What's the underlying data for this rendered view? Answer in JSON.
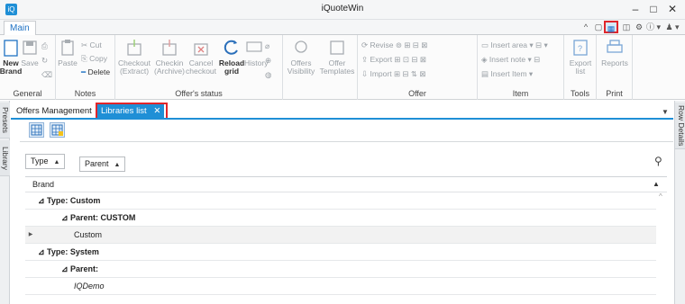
{
  "window": {
    "title": "iQuoteWin",
    "min": "–",
    "max": "□",
    "close": "✕"
  },
  "ribbon_tabs": {
    "main": "Main"
  },
  "quick_access": {
    "collapse": "^",
    "icon2": "▢",
    "grid_icon": "▦",
    "icon4": "◫",
    "settings": "⚙",
    "info": "ⓘ ▾",
    "user": "♟ ▾"
  },
  "ribbon": {
    "general": {
      "label": "General",
      "new_brand": "New Brand",
      "save": "Save"
    },
    "notes": {
      "label": "Notes",
      "paste": "Paste",
      "cut": "Cut",
      "copy": "Copy",
      "delete": "Delete"
    },
    "offer_status": {
      "label": "Offer's status",
      "checkout": "Checkout (Extract)",
      "checkin": "Checkin (Archive)",
      "cancel_checkout": "Cancel checkout",
      "reload_grid": "Reload grid",
      "history": "History",
      "offers_visibility": "Offers Visibility",
      "offer_templates": "Offer Templates"
    },
    "offer": {
      "label": "Offer",
      "revise": "Revise",
      "export": "Export",
      "import": "Import"
    },
    "item": {
      "label": "Item",
      "insert_area": "Insert area",
      "insert_note": "Insert note",
      "insert_item": "Insert Item"
    },
    "tools": {
      "label": "Tools",
      "export_list": "Export list"
    },
    "print": {
      "label": "Print",
      "reports": "Reports"
    }
  },
  "side": {
    "presets": "Presets",
    "library": "Library",
    "row_details": "Row Details"
  },
  "doc_tabs": {
    "offers_management": "Offers Management",
    "libraries_list": "Libraries list",
    "close": "✕"
  },
  "group_panel": {
    "type": "Type",
    "parent": "Parent",
    "sort_up": "▲"
  },
  "grid": {
    "header": "Brand",
    "rows": [
      {
        "text": "⊿ Type: Custom"
      },
      {
        "text": "⊿ Parent: CUSTOM"
      },
      {
        "text": "Custom"
      },
      {
        "text": "⊿ Type: System"
      },
      {
        "text": "⊿ Parent:"
      },
      {
        "text": "IQDemo"
      }
    ],
    "row_indicator": "▶"
  },
  "colors": {
    "accent": "#1f8fd6",
    "highlight": "#e0262b"
  }
}
